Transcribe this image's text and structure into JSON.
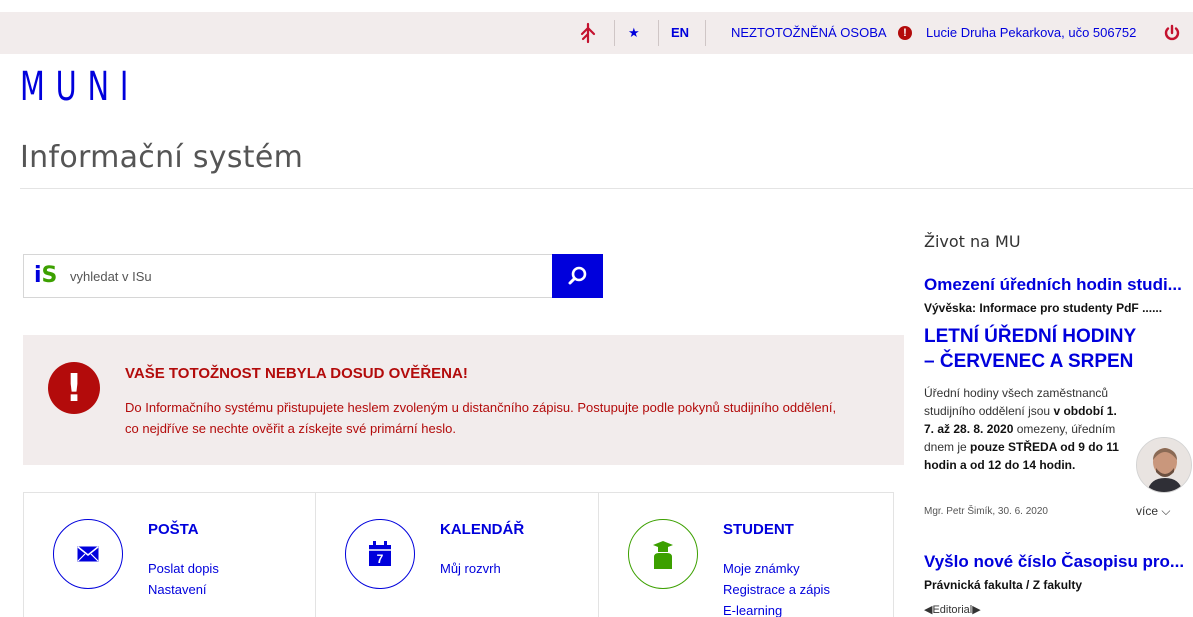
{
  "topbar": {
    "lang": "EN",
    "identity_status": "NEZTOTOŽNĚNÁ OSOBA",
    "user": "Lucie Druha Pekarkova, učo 506752"
  },
  "logo": "MUNI",
  "app_title": "Informační systém",
  "search": {
    "placeholder": "vyhledat v ISu"
  },
  "alert": {
    "title": "VAŠE TOTOŽNOST NEBYLA DOSUD OVĚŘENA!",
    "text": "Do Informačního systému přistupujete heslem zvoleným u distančního zápisu. Postupujte podle pokynů studijního oddělení, co nejdříve se nechte ověřit a získejte své primární heslo."
  },
  "tiles": [
    {
      "title": "POŠTA",
      "links": [
        "Poslat dopis",
        "Nastavení"
      ]
    },
    {
      "title": "KALENDÁŘ",
      "links": [
        "Můj rozvrh"
      ],
      "calendar_day": "7"
    },
    {
      "title": "STUDENT",
      "links": [
        "Moje známky",
        "Registrace a zápis",
        "E-learning"
      ]
    }
  ],
  "aside": {
    "heading": "Život na MU",
    "news1": {
      "title": "Omezení úředních hodin studi...",
      "source": "Vývěska: Informace pro studenty PdF ......",
      "headline": "LETNÍ ÚŘEDNÍ HODINY – ČERVENEC A SRPEN",
      "body_1": "Úřední hodiny všech zaměstnanců studijního oddělení jsou ",
      "body_2": "v období 1. 7. až 28. 8. 2020",
      "body_3": " omezeny, úředním dnem je ",
      "body_4": "pouze STŘEDA od 9 do 11 hodin a od 12 do 14 hodin.",
      "meta": "Mgr. Petr Šimík, 30. 6. 2020",
      "more": "více"
    },
    "news2": {
      "title": "Vyšlo nové číslo Časopisu pro...",
      "source": "Právnická fakulta / Z fakulty",
      "tag": "Editorial"
    }
  },
  "colors": {
    "brand_blue": "#0000dc",
    "alert_red": "#b30b0b",
    "student_green": "#3ca000",
    "panel_bg": "#f2ecec"
  },
  "icons": [
    "pin-icon",
    "star-icon",
    "info-icon",
    "power-icon",
    "search-icon",
    "alert-icon",
    "mail-icon",
    "calendar-icon",
    "student-icon",
    "chevron-down-icon"
  ]
}
